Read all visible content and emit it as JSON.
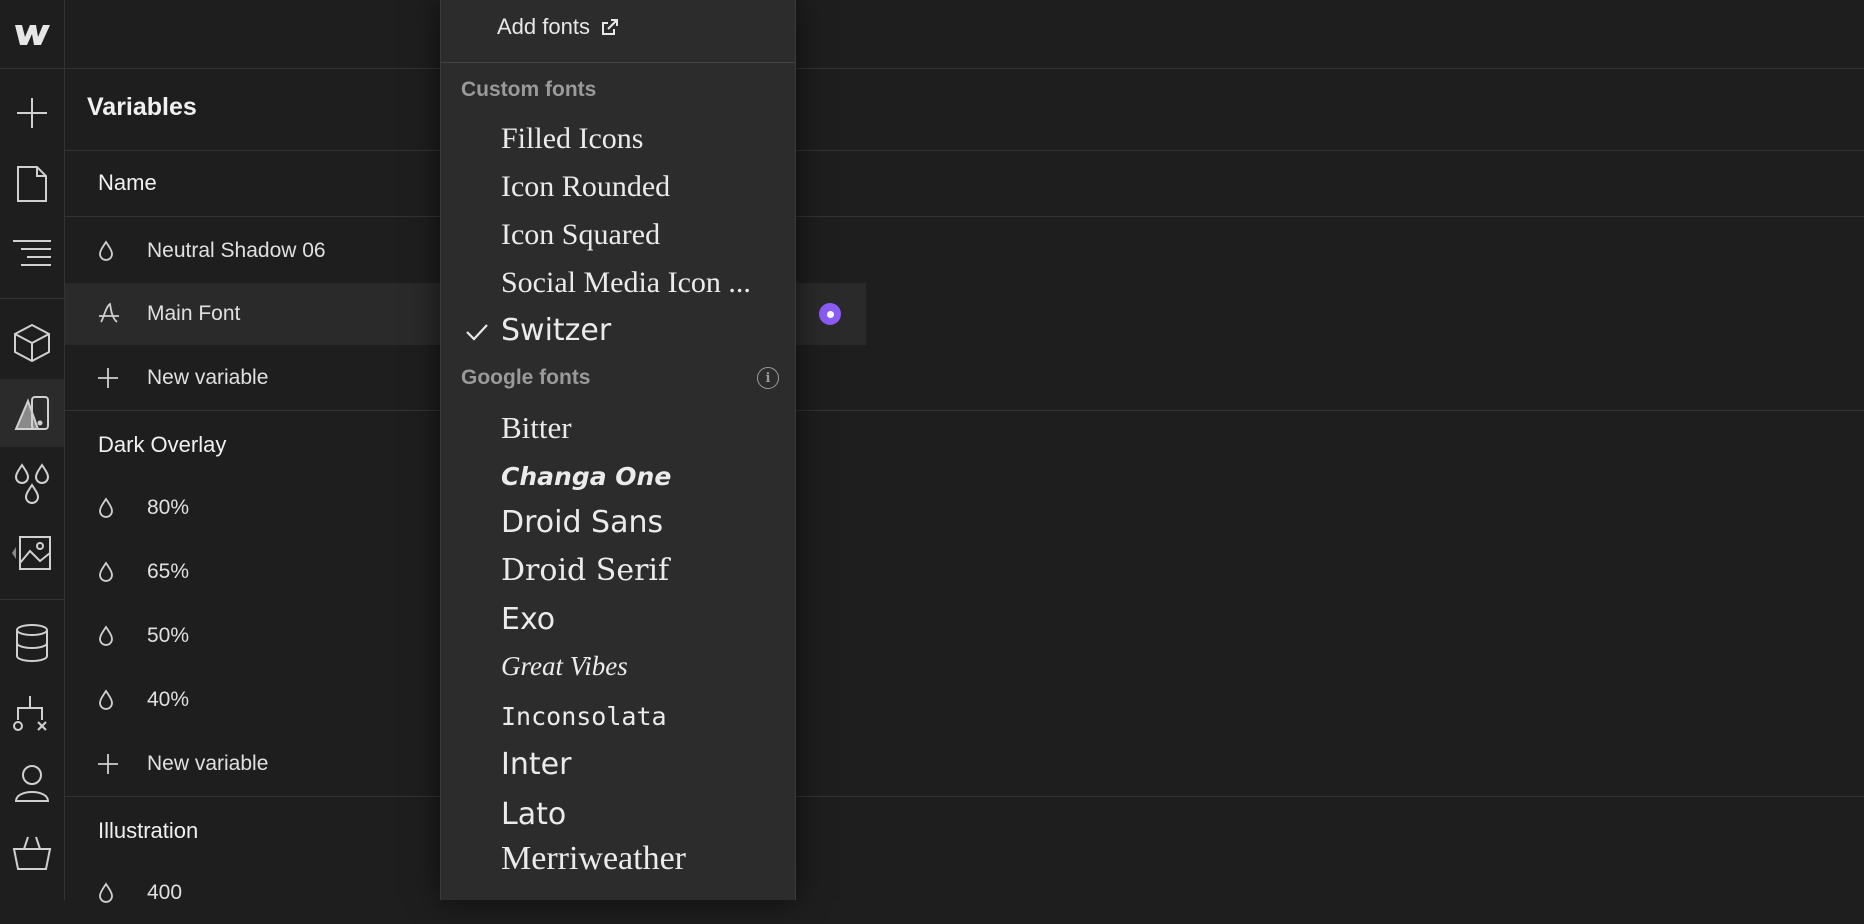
{
  "panel": {
    "title": "Variables",
    "column_header": "Name"
  },
  "rows": [
    {
      "label": "Neutral Shadow 06",
      "icon": "drop-icon"
    },
    {
      "label": "Main Font",
      "icon": "font-icon"
    },
    {
      "label": "New variable",
      "icon": "plus-icon"
    }
  ],
  "groups": [
    {
      "title": "Dark Overlay",
      "rows": [
        {
          "label": "80%",
          "icon": "drop-icon"
        },
        {
          "label": "65%",
          "icon": "drop-icon"
        },
        {
          "label": "50%",
          "icon": "drop-icon"
        },
        {
          "label": "40%",
          "icon": "drop-icon"
        },
        {
          "label": "New variable",
          "icon": "plus-icon"
        }
      ]
    },
    {
      "title": "Illustration",
      "rows": [
        {
          "label": "400",
          "icon": "drop-icon"
        }
      ]
    }
  ],
  "dropdown": {
    "add_fonts": "Add fonts",
    "custom_header": "Custom fonts",
    "custom_fonts": [
      "Filled Icons",
      "Icon Rounded",
      "Icon Squared",
      "Social Media Icon ...",
      "Switzer"
    ],
    "selected_font": "Switzer",
    "google_header": "Google fonts",
    "google_fonts": [
      "Bitter",
      "Changa One",
      "Droid Sans",
      "Droid Serif",
      "Exo",
      "Great Vibes",
      "Inconsolata",
      "Inter",
      "Lato",
      "Merriweather"
    ]
  },
  "accent_color": "#8b5cf6",
  "rail_icons": [
    "webflow-logo-icon",
    "add-icon",
    "pages-icon",
    "navigator-icon",
    "components-icon",
    "style-variables-icon",
    "colors-icon",
    "assets-icon",
    "cms-icon",
    "logic-icon",
    "users-icon",
    "ecommerce-icon"
  ]
}
